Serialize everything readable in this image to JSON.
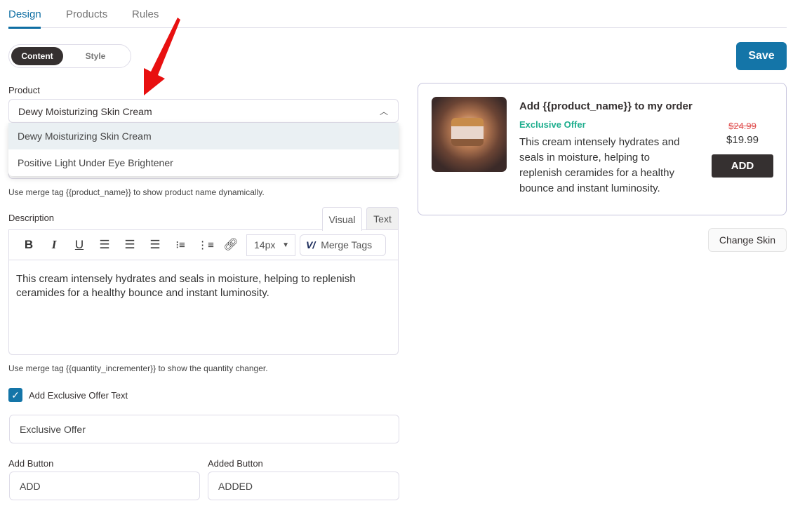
{
  "tabs": [
    {
      "label": "Design"
    },
    {
      "label": "Products"
    },
    {
      "label": "Rules"
    }
  ],
  "toggle": {
    "content": "Content",
    "style": "Style"
  },
  "save_label": "Save",
  "product": {
    "label": "Product",
    "selected": "Dewy Moisturizing Skin Cream",
    "options": [
      "Dewy Moisturizing Skin Cream",
      "Positive Light Under Eye Brightener"
    ],
    "help": "Use merge tag {{product_name}} to show product name dynamically."
  },
  "description": {
    "label": "Description",
    "tab_visual": "Visual",
    "tab_text": "Text",
    "font_size": "14px",
    "merge_tags": "Merge Tags",
    "body": "This cream intensely hydrates and seals in moisture, helping to replenish ceramides for a healthy bounce and instant luminosity.",
    "help": "Use merge tag {{quantity_incrementer}} to show the quantity changer."
  },
  "exclusive": {
    "checkbox_label": "Add Exclusive Offer Text",
    "checked": true,
    "value": "Exclusive Offer"
  },
  "add_button": {
    "label": "Add Button",
    "value": "ADD"
  },
  "added_button": {
    "label": "Added Button",
    "value": "ADDED"
  },
  "preview": {
    "title": "Add {{product_name}} to my order",
    "offer": "Exclusive Offer",
    "description": "This cream intensely hydrates and seals in moisture, helping to replenish ceramides for a healthy bounce and instant luminosity.",
    "old_price": "$24.99",
    "price": "$19.99",
    "button": "ADD"
  },
  "change_skin": "Change Skin",
  "colors": {
    "accent": "#1475a8",
    "offer": "#1fae8e",
    "old_price": "#e05050",
    "dark": "#353030",
    "arrow": "#e81010"
  }
}
